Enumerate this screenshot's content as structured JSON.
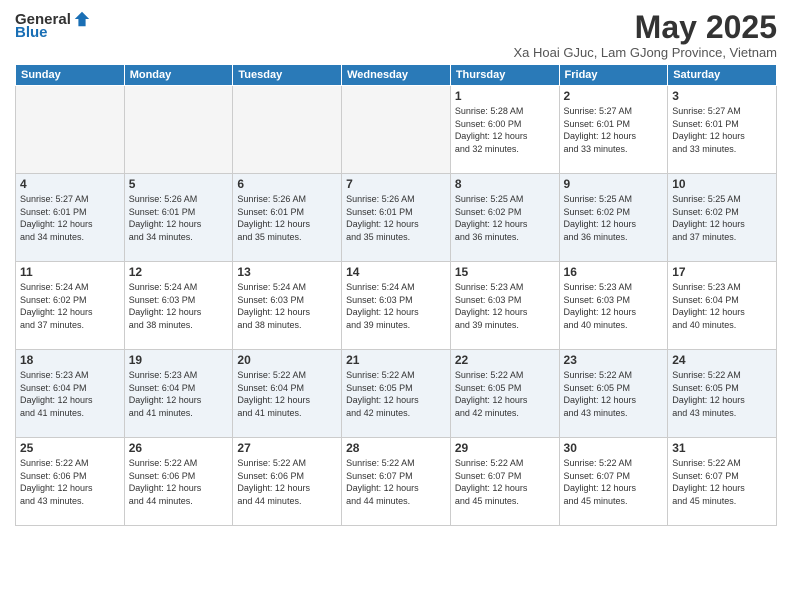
{
  "logo": {
    "general": "General",
    "blue": "Blue"
  },
  "header": {
    "month": "May 2025",
    "subtitle": "Xa Hoai GJuc, Lam GJong Province, Vietnam"
  },
  "weekdays": [
    "Sunday",
    "Monday",
    "Tuesday",
    "Wednesday",
    "Thursday",
    "Friday",
    "Saturday"
  ],
  "weeks": [
    [
      {
        "day": "",
        "info": ""
      },
      {
        "day": "",
        "info": ""
      },
      {
        "day": "",
        "info": ""
      },
      {
        "day": "",
        "info": ""
      },
      {
        "day": "1",
        "info": "Sunrise: 5:28 AM\nSunset: 6:00 PM\nDaylight: 12 hours\nand 32 minutes."
      },
      {
        "day": "2",
        "info": "Sunrise: 5:27 AM\nSunset: 6:01 PM\nDaylight: 12 hours\nand 33 minutes."
      },
      {
        "day": "3",
        "info": "Sunrise: 5:27 AM\nSunset: 6:01 PM\nDaylight: 12 hours\nand 33 minutes."
      }
    ],
    [
      {
        "day": "4",
        "info": "Sunrise: 5:27 AM\nSunset: 6:01 PM\nDaylight: 12 hours\nand 34 minutes."
      },
      {
        "day": "5",
        "info": "Sunrise: 5:26 AM\nSunset: 6:01 PM\nDaylight: 12 hours\nand 34 minutes."
      },
      {
        "day": "6",
        "info": "Sunrise: 5:26 AM\nSunset: 6:01 PM\nDaylight: 12 hours\nand 35 minutes."
      },
      {
        "day": "7",
        "info": "Sunrise: 5:26 AM\nSunset: 6:01 PM\nDaylight: 12 hours\nand 35 minutes."
      },
      {
        "day": "8",
        "info": "Sunrise: 5:25 AM\nSunset: 6:02 PM\nDaylight: 12 hours\nand 36 minutes."
      },
      {
        "day": "9",
        "info": "Sunrise: 5:25 AM\nSunset: 6:02 PM\nDaylight: 12 hours\nand 36 minutes."
      },
      {
        "day": "10",
        "info": "Sunrise: 5:25 AM\nSunset: 6:02 PM\nDaylight: 12 hours\nand 37 minutes."
      }
    ],
    [
      {
        "day": "11",
        "info": "Sunrise: 5:24 AM\nSunset: 6:02 PM\nDaylight: 12 hours\nand 37 minutes."
      },
      {
        "day": "12",
        "info": "Sunrise: 5:24 AM\nSunset: 6:03 PM\nDaylight: 12 hours\nand 38 minutes."
      },
      {
        "day": "13",
        "info": "Sunrise: 5:24 AM\nSunset: 6:03 PM\nDaylight: 12 hours\nand 38 minutes."
      },
      {
        "day": "14",
        "info": "Sunrise: 5:24 AM\nSunset: 6:03 PM\nDaylight: 12 hours\nand 39 minutes."
      },
      {
        "day": "15",
        "info": "Sunrise: 5:23 AM\nSunset: 6:03 PM\nDaylight: 12 hours\nand 39 minutes."
      },
      {
        "day": "16",
        "info": "Sunrise: 5:23 AM\nSunset: 6:03 PM\nDaylight: 12 hours\nand 40 minutes."
      },
      {
        "day": "17",
        "info": "Sunrise: 5:23 AM\nSunset: 6:04 PM\nDaylight: 12 hours\nand 40 minutes."
      }
    ],
    [
      {
        "day": "18",
        "info": "Sunrise: 5:23 AM\nSunset: 6:04 PM\nDaylight: 12 hours\nand 41 minutes."
      },
      {
        "day": "19",
        "info": "Sunrise: 5:23 AM\nSunset: 6:04 PM\nDaylight: 12 hours\nand 41 minutes."
      },
      {
        "day": "20",
        "info": "Sunrise: 5:22 AM\nSunset: 6:04 PM\nDaylight: 12 hours\nand 41 minutes."
      },
      {
        "day": "21",
        "info": "Sunrise: 5:22 AM\nSunset: 6:05 PM\nDaylight: 12 hours\nand 42 minutes."
      },
      {
        "day": "22",
        "info": "Sunrise: 5:22 AM\nSunset: 6:05 PM\nDaylight: 12 hours\nand 42 minutes."
      },
      {
        "day": "23",
        "info": "Sunrise: 5:22 AM\nSunset: 6:05 PM\nDaylight: 12 hours\nand 43 minutes."
      },
      {
        "day": "24",
        "info": "Sunrise: 5:22 AM\nSunset: 6:05 PM\nDaylight: 12 hours\nand 43 minutes."
      }
    ],
    [
      {
        "day": "25",
        "info": "Sunrise: 5:22 AM\nSunset: 6:06 PM\nDaylight: 12 hours\nand 43 minutes."
      },
      {
        "day": "26",
        "info": "Sunrise: 5:22 AM\nSunset: 6:06 PM\nDaylight: 12 hours\nand 44 minutes."
      },
      {
        "day": "27",
        "info": "Sunrise: 5:22 AM\nSunset: 6:06 PM\nDaylight: 12 hours\nand 44 minutes."
      },
      {
        "day": "28",
        "info": "Sunrise: 5:22 AM\nSunset: 6:07 PM\nDaylight: 12 hours\nand 44 minutes."
      },
      {
        "day": "29",
        "info": "Sunrise: 5:22 AM\nSunset: 6:07 PM\nDaylight: 12 hours\nand 45 minutes."
      },
      {
        "day": "30",
        "info": "Sunrise: 5:22 AM\nSunset: 6:07 PM\nDaylight: 12 hours\nand 45 minutes."
      },
      {
        "day": "31",
        "info": "Sunrise: 5:22 AM\nSunset: 6:07 PM\nDaylight: 12 hours\nand 45 minutes."
      }
    ]
  ]
}
